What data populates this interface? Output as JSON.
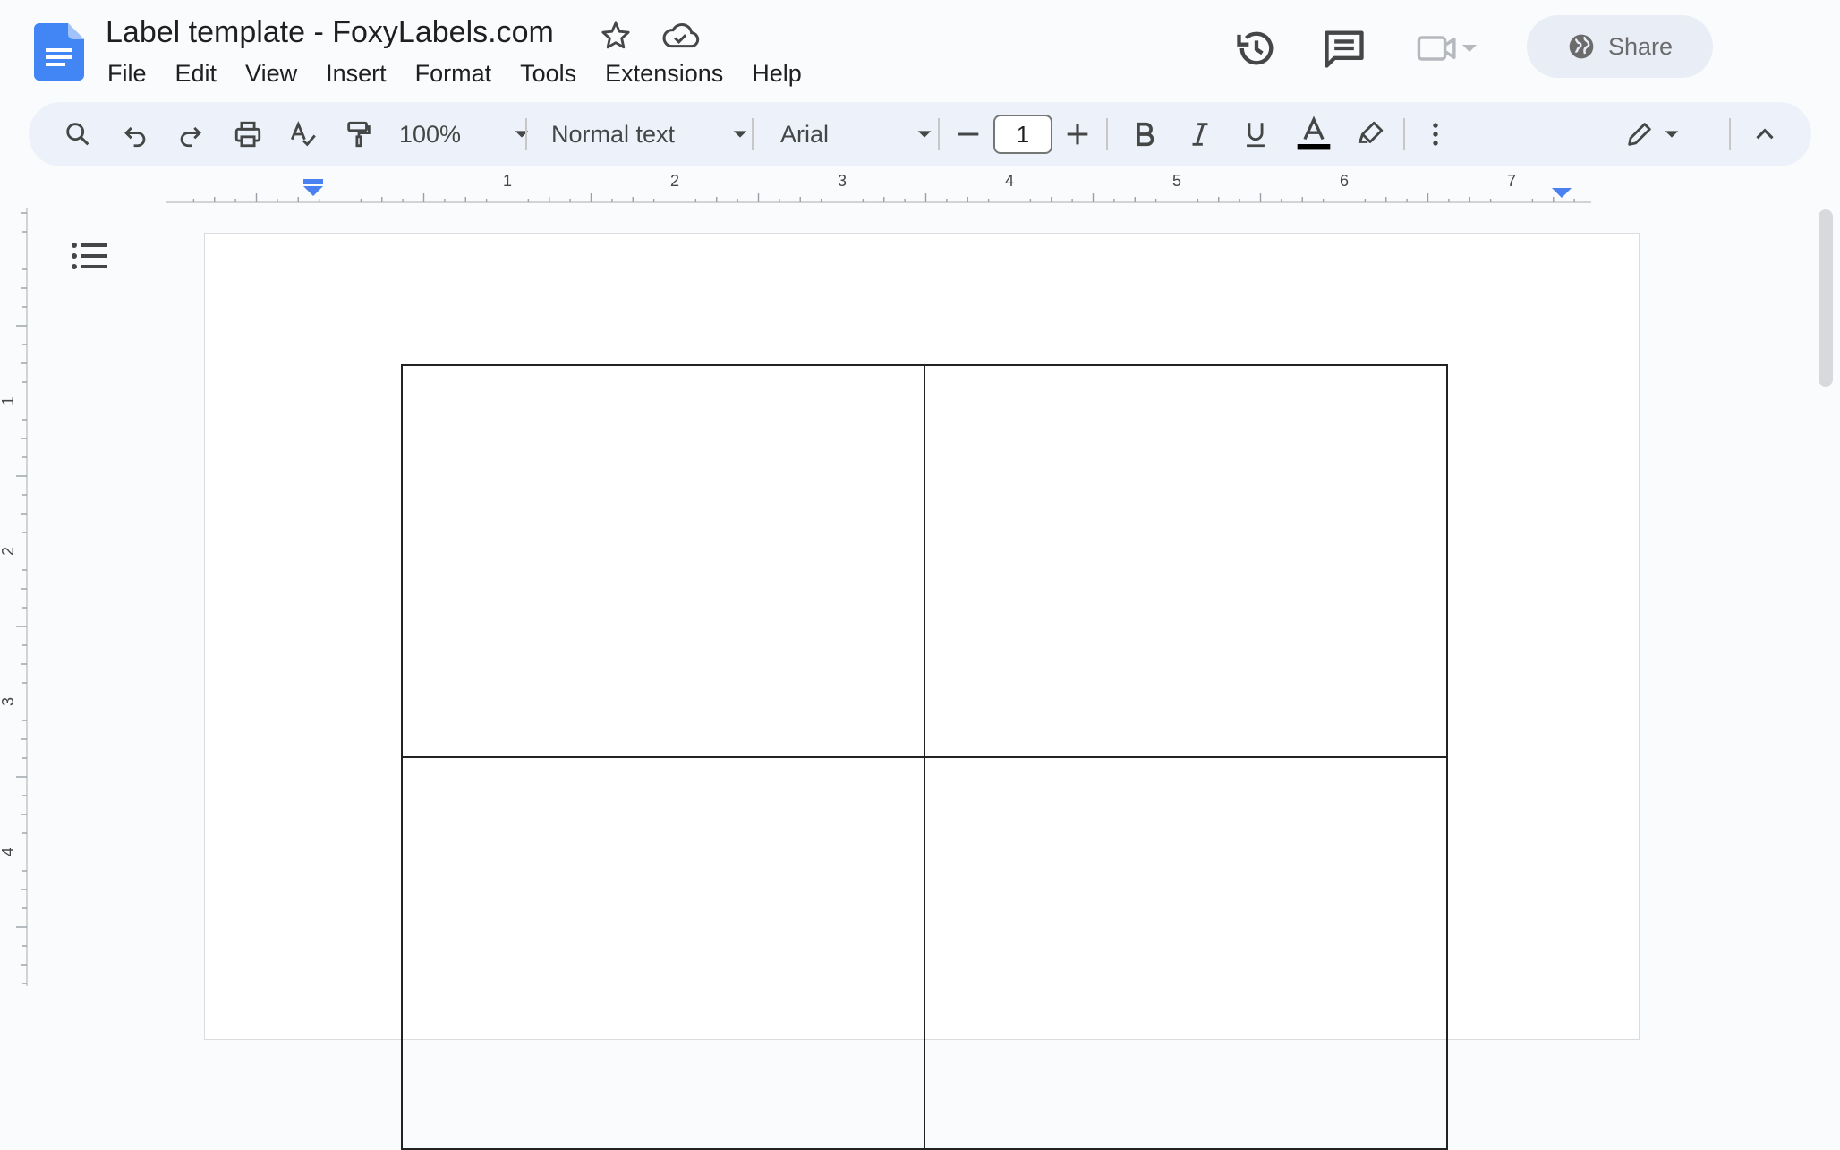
{
  "app": {
    "title": "Label template - FoxyLabels.com"
  },
  "menu": {
    "items": [
      "File",
      "Edit",
      "View",
      "Insert",
      "Format",
      "Tools",
      "Extensions",
      "Help"
    ]
  },
  "header": {
    "share_label": "Share"
  },
  "toolbar": {
    "zoom": "100%",
    "style": "Normal text",
    "font": "Arial",
    "font_size": "1"
  },
  "ruler": {
    "horizontal_labels": [
      "1",
      "2",
      "3",
      "4",
      "5",
      "6",
      "7"
    ],
    "vertical_labels": [
      "1",
      "2",
      "3",
      "4"
    ]
  },
  "document": {
    "table": {
      "rows": 2,
      "columns": 2,
      "cells": [
        [
          "",
          ""
        ],
        [
          "",
          ""
        ]
      ]
    }
  },
  "colors": {
    "brand_blue": "#4285f4",
    "toolbar_bg": "#edf2fa",
    "share_bg": "#e9eef6",
    "text_color_bar": "#000000"
  },
  "icons": [
    "docs-logo-icon",
    "star-icon",
    "cloud-icon",
    "history-icon",
    "comments-icon",
    "meet-icon",
    "globe-icon",
    "search-icon",
    "undo-icon",
    "redo-icon",
    "print-icon",
    "spellcheck-icon",
    "paint-format-icon",
    "bold-icon",
    "italic-icon",
    "underline-icon",
    "text-color-icon",
    "highlight-icon",
    "more-options-icon",
    "editing-mode-icon",
    "collapse-toolbar-icon",
    "outline-icon"
  ]
}
